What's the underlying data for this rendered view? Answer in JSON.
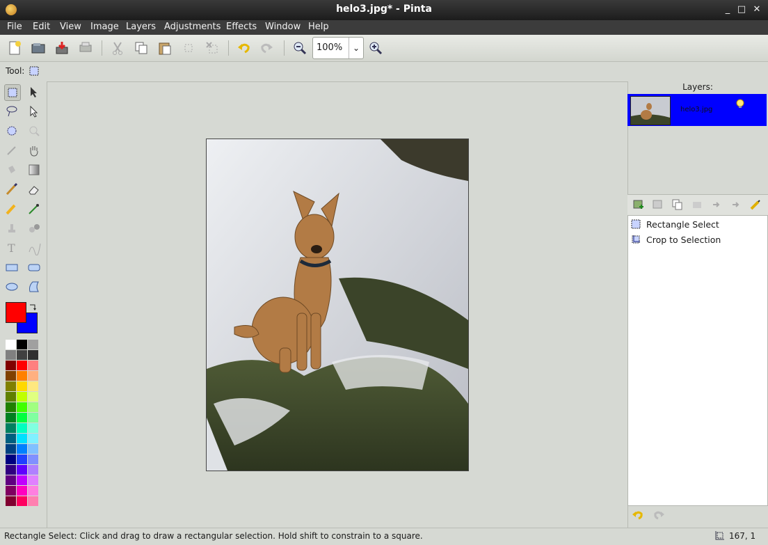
{
  "window": {
    "title": "helo3.jpg* - Pinta",
    "min": "_",
    "max": "□",
    "close": "✕"
  },
  "menu": [
    "File",
    "Edit",
    "View",
    "Image",
    "Layers",
    "Adjustments",
    "Effects",
    "Window",
    "Help"
  ],
  "toolbar": {
    "zoom_value": "100%"
  },
  "toolrow": {
    "label": "Tool:"
  },
  "layers": {
    "title": "Layers:",
    "items": [
      {
        "name": "helo3.jpg",
        "visible": true
      }
    ]
  },
  "history": {
    "items": [
      {
        "label": "Rectangle Select",
        "icon": "rectangle-select-icon"
      },
      {
        "label": "Crop to Selection",
        "icon": "crop-icon"
      }
    ]
  },
  "colors": {
    "primary": "#ff0000",
    "secondary": "#0000ff",
    "layer_highlight": "#0000ff"
  },
  "status": {
    "message": "Rectangle Select: Click and drag to draw a rectangular selection. Hold shift to constrain to a square.",
    "position": "167, 1"
  }
}
